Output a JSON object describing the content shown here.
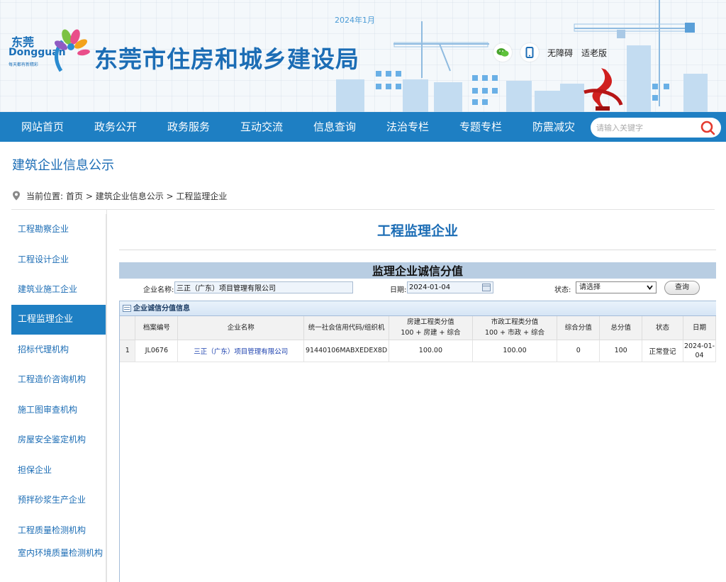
{
  "header": {
    "date": "2024年1月",
    "logo": {
      "name_cn": "东莞",
      "name_en": "Dongguan",
      "slogan": "每天都有新精彩"
    },
    "site_title": "东莞市住房和城乡建设局",
    "accessibility": "无障碍",
    "elderly_mode": "适老版",
    "icons": [
      "wechat-icon",
      "mobile-icon"
    ]
  },
  "nav": {
    "items": [
      "网站首页",
      "政务公开",
      "政务服务",
      "互动交流",
      "信息查询",
      "法治专栏",
      "专题专栏",
      "防震减灾"
    ],
    "search_placeholder": "请输入关键字"
  },
  "page": {
    "heading": "建筑企业信息公示",
    "breadcrumb": {
      "label": "当前位置:",
      "path": "首页 > 建筑企业信息公示 > 工程监理企业"
    }
  },
  "sidebar": {
    "items": [
      "工程勘察企业",
      "工程设计企业",
      "建筑业施工企业",
      "工程监理企业",
      "招标代理机构",
      "工程造价咨询机构",
      "施工图审查机构",
      "房屋安全鉴定机构",
      "担保企业",
      "预拌砂浆生产企业",
      "工程质量检测机构",
      "室内环境质量检测机构"
    ],
    "active_index": 3
  },
  "main": {
    "title": "工程监理企业",
    "panel_title": "监理企业诚信分值",
    "filters": {
      "company_label": "企业名称:",
      "company_value": "三正（广东）项目管理有限公司",
      "date_label": "日期:",
      "date_value": "2024-01-04",
      "status_label": "状态:",
      "status_value": "请选择",
      "query_button": "查询"
    },
    "grid": {
      "caption": "企业诚信分值信息",
      "columns": [
        "档案编号",
        "企业名称",
        "统一社会信用代码/组织机",
        "房建工程类分值\n100 + 房建 + 综合",
        "市政工程类分值\n100 + 市政 + 综合",
        "综合分值",
        "总分值",
        "状态",
        "日期"
      ],
      "rows": [
        {
          "index": "1",
          "file_no": "JL0676",
          "company": "三正（广东）项目管理有限公司",
          "credit_code": "91440106MABXEDEX8D",
          "housing_score": "100.00",
          "municipal_score": "100.00",
          "composite": "0",
          "total": "100",
          "status": "正常登记",
          "date": "2024-01-04"
        }
      ]
    }
  },
  "colors": {
    "brand_blue": "#1e7fc3",
    "title_blue": "#1c6db5",
    "panel_bar": "#b8cde2",
    "link": "#1a3fae"
  }
}
